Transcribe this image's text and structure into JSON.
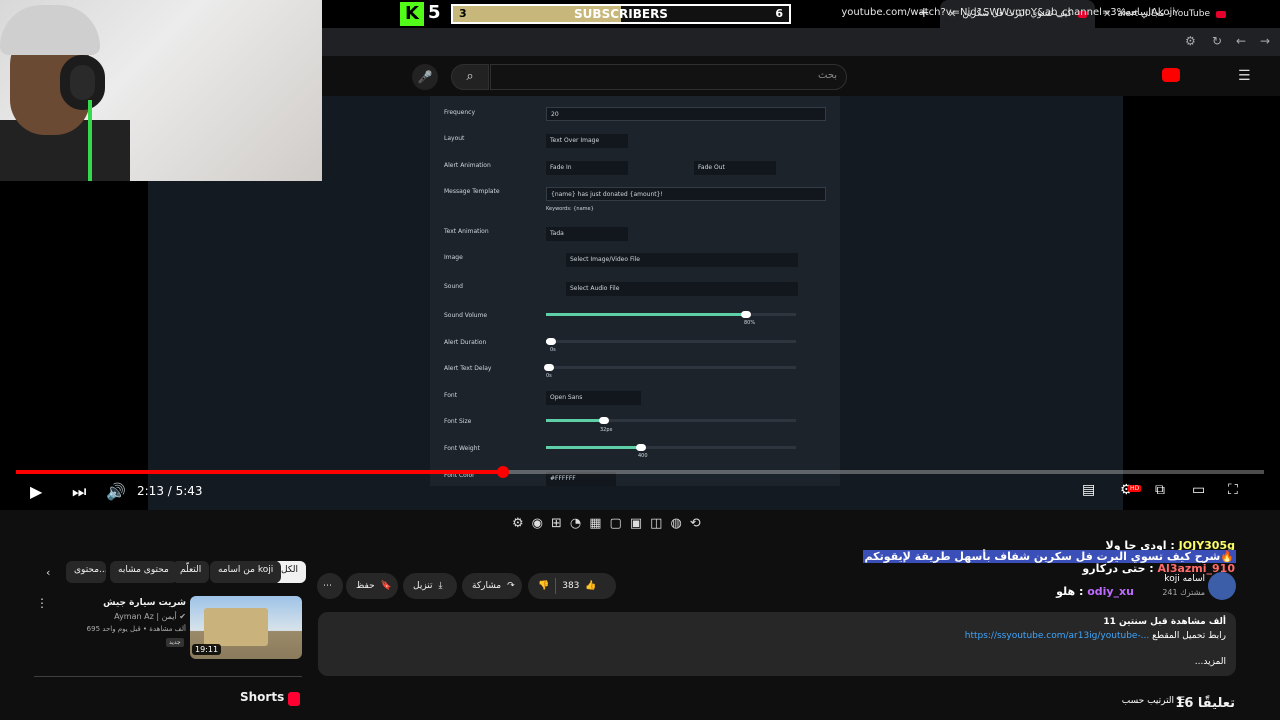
{
  "browser": {
    "tabs": [
      {
        "title": "alert مجاني - YouTube"
      },
      {
        "title": "شرح كيف تسوي اليرت فل سكرين"
      }
    ],
    "url": "youtube.com/watch?v=Nid1SWWvmoY&ab_channel=3%اسامهAkoji"
  },
  "overlay": {
    "kick_logo": "K",
    "viewer_count": "5",
    "subscriber_goal": {
      "current": "3",
      "label": "SUBSCRIBERS",
      "target": "6",
      "progress": 0.5
    }
  },
  "youtube_header": {
    "search_placeholder": "بحث"
  },
  "video_frame": {
    "settings": [
      {
        "label": "Frequency",
        "value": "20"
      },
      {
        "label": "Layout",
        "value": "Text Over Image"
      },
      {
        "label": "Alert Animation",
        "value": "Fade In",
        "value2": "Fade Out"
      },
      {
        "label": "Message Template",
        "value": "{name} has just donated {amount}!",
        "hint": "Keywords: {name}"
      },
      {
        "label": "Text Animation",
        "value": "Tada"
      },
      {
        "label": "Image",
        "value": "Select Image/Video File"
      },
      {
        "label": "Sound",
        "value": "Select Audio File"
      },
      {
        "label": "Sound Volume",
        "value": "80%",
        "level": 0.8
      },
      {
        "label": "Alert Duration",
        "value": "0s",
        "level": 0.02
      },
      {
        "label": "Alert Text Delay",
        "value": "0s",
        "level": 0.01
      },
      {
        "label": "Font",
        "value": "Open Sans"
      },
      {
        "label": "Font Size",
        "value": "32px",
        "level": 0.23
      },
      {
        "label": "Font Weight",
        "value": "400",
        "level": 0.38
      },
      {
        "label": "Font Color",
        "value": "#FFFFFF"
      }
    ]
  },
  "player": {
    "current_time": "2:13",
    "duration": "5:43",
    "time_display": "2:13 / 5:43",
    "progress": 0.39,
    "hd_badge": "HD"
  },
  "chat": [
    {
      "user": "JOJY305g",
      "text": "اودي جا ولا"
    },
    {
      "user": "",
      "text": "شرح كيف تسوي اليرت فل سكرين شفاف بأسهل طريقة لإيقوتكم🔥"
    },
    {
      "user": "Al3azmi_910",
      "text": "حتى دركارو"
    },
    {
      "user": "odiy_xu",
      "text": "هلو"
    }
  ],
  "channel": {
    "name": "koji اسامه",
    "subscribers": "241 مشترك"
  },
  "actions": {
    "likes": "383",
    "share": "مشاركة",
    "download": "تنزيل",
    "save": "حفظ",
    "more": "⋯"
  },
  "description": {
    "views_line": "11 ألف مشاهدة  قبل سنتين",
    "link_label": "رابط تحميل المقطع",
    "link": "https://ssyoutube.com/ar13ig/youtube-...",
    "more": "...المزيد"
  },
  "comments": {
    "count": "16 تعليقًا",
    "sort": "الترتيب حسب"
  },
  "sidebar": {
    "chips": [
      "الكل",
      "من اسامه koji",
      "التعلّم",
      "محتوى مشابه",
      "محتوى..."
    ],
    "recommendation": {
      "title": "شريت سيارة جيش",
      "channel": "Ayman Az | أيمن",
      "meta": "695 ألف مشاهدة • قبل يوم واحد",
      "badge": "جديد",
      "duration": "19:11"
    },
    "shorts_title": "Shorts"
  }
}
